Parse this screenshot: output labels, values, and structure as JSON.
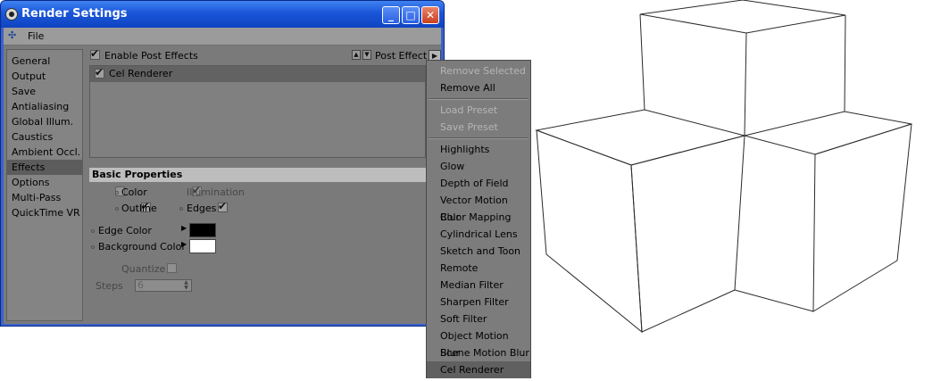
{
  "window": {
    "title": "Render Settings",
    "menu": {
      "file_label": "File"
    }
  },
  "sidebar": {
    "items": [
      {
        "label": "General"
      },
      {
        "label": "Output"
      },
      {
        "label": "Save"
      },
      {
        "label": "Antialiasing"
      },
      {
        "label": "Global Illum."
      },
      {
        "label": "Caustics"
      },
      {
        "label": "Ambient Occl."
      },
      {
        "label": "Effects",
        "selected": true
      },
      {
        "label": "Options"
      },
      {
        "label": "Multi-Pass"
      },
      {
        "label": "QuickTime VR"
      }
    ]
  },
  "effects": {
    "enable_post_effects_label": "Enable Post Effects",
    "enable_post_effects_checked": true,
    "post_effect_label": "Post Effect",
    "list": [
      {
        "label": "Cel Renderer",
        "checked": true
      }
    ]
  },
  "basic_properties": {
    "header": "Basic Properties",
    "color_label": "Color",
    "color_checked": false,
    "illumination_label": "Illumination",
    "illumination_checked": true,
    "outline_label": "Outline",
    "outline_checked": true,
    "edges_label": "Edges",
    "edges_checked": true,
    "edge_color_label": "Edge Color",
    "edge_color_value": "#000000",
    "background_color_label": "Background Color",
    "background_color_value": "#ffffff",
    "quantize_label": "Quantize",
    "quantize_checked": false,
    "steps_label": "Steps",
    "steps_value": "6"
  },
  "dropdown": {
    "groups": [
      [
        {
          "label": "Remove Selected",
          "disabled": true
        },
        {
          "label": "Remove All"
        }
      ],
      [
        {
          "label": "Load Preset",
          "disabled": true
        },
        {
          "label": "Save Preset",
          "disabled": true
        }
      ],
      [
        {
          "label": "Highlights"
        },
        {
          "label": "Glow"
        },
        {
          "label": "Depth of Field"
        },
        {
          "label": "Vector Motion Blur"
        },
        {
          "label": "Color Mapping"
        },
        {
          "label": "Cylindrical Lens"
        },
        {
          "label": "Sketch and Toon"
        },
        {
          "label": "Remote"
        },
        {
          "label": "Median Filter"
        },
        {
          "label": "Sharpen Filter"
        },
        {
          "label": "Soft Filter"
        },
        {
          "label": "Object Motion Blur"
        },
        {
          "label": "Scene Motion Blur"
        },
        {
          "label": "Cel Renderer",
          "highlighted": true
        }
      ]
    ]
  }
}
